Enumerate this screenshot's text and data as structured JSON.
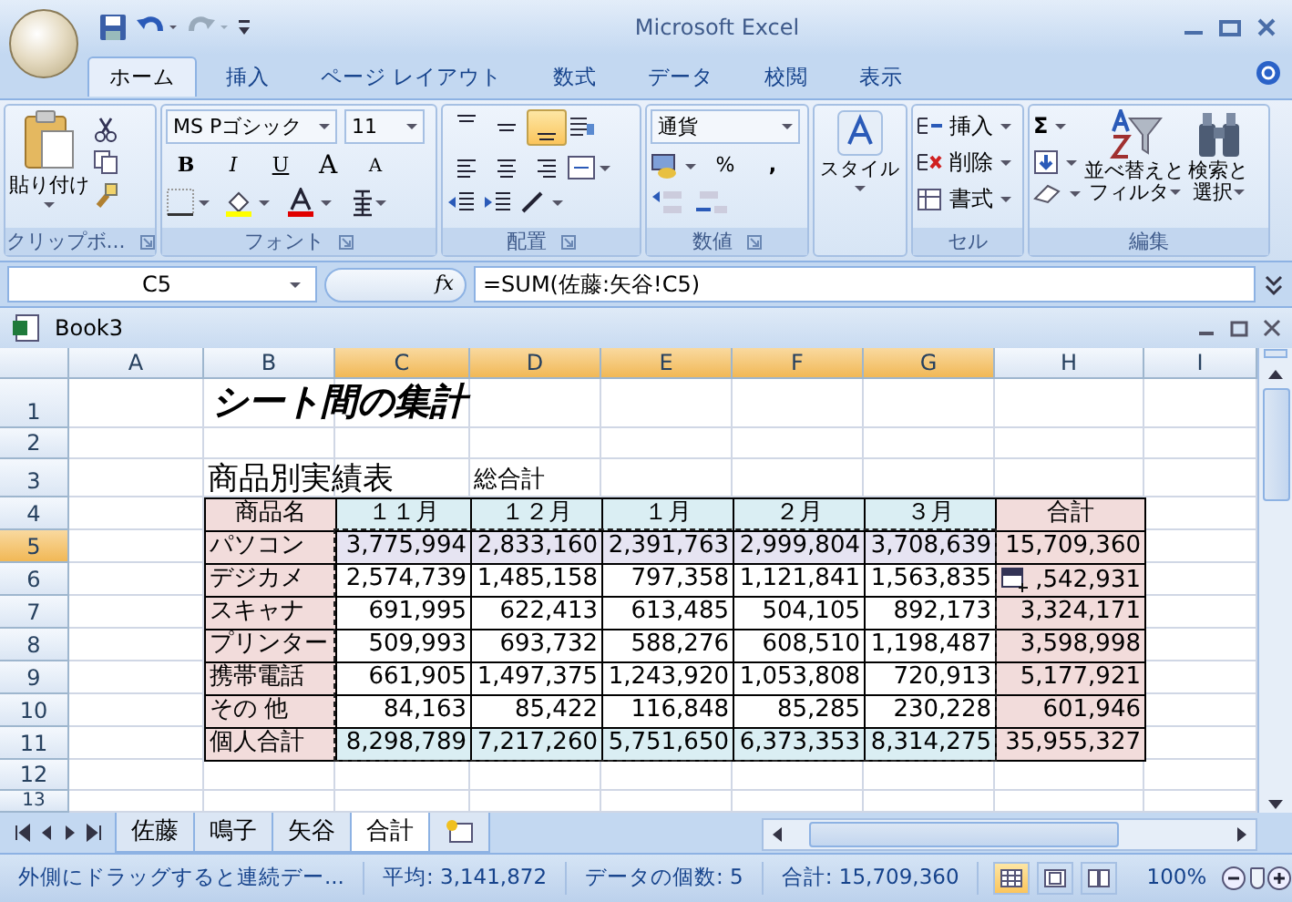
{
  "window": {
    "title": "Microsoft Excel"
  },
  "ribbon_tabs": [
    {
      "label": "ホーム",
      "selected": true
    },
    {
      "label": "挿入",
      "selected": false
    },
    {
      "label": "ページ レイアウト",
      "selected": false
    },
    {
      "label": "数式",
      "selected": false
    },
    {
      "label": "データ",
      "selected": false
    },
    {
      "label": "校閲",
      "selected": false
    },
    {
      "label": "表示",
      "selected": false
    }
  ],
  "clipboard": {
    "paste": "貼り付け",
    "label": "クリップボ..."
  },
  "font": {
    "name": "MS Pゴシック",
    "size": "11",
    "styles": [
      "B",
      "I",
      "U"
    ],
    "grow": "A",
    "shrink": "A",
    "label": "フォント"
  },
  "alignment": {
    "vertical": [
      {
        "selected": false
      },
      {
        "selected": false
      },
      {
        "selected": true
      }
    ],
    "label": "配置"
  },
  "number": {
    "format": "通貨",
    "percent": "%",
    "comma": ",",
    "label": "数値"
  },
  "styles": {
    "button": "スタイル"
  },
  "cells": {
    "buttons": [
      "挿入",
      "削除",
      "書式"
    ],
    "label": "セル"
  },
  "editing": {
    "sum": "Σ",
    "sort": [
      "並べ替えと",
      "フィルタ"
    ],
    "find": [
      "検索と",
      "選択"
    ],
    "label": "編集"
  },
  "formula_bar": {
    "name_box": "C5",
    "fx": "fx",
    "formula": "=SUM(佐藤:矢谷!C5)"
  },
  "workbook": {
    "title": "Book3"
  },
  "sheet": {
    "columns": [
      {
        "label": "A",
        "selected": false
      },
      {
        "label": "B",
        "selected": false
      },
      {
        "label": "C",
        "selected": true
      },
      {
        "label": "D",
        "selected": true
      },
      {
        "label": "E",
        "selected": true
      },
      {
        "label": "F",
        "selected": true
      },
      {
        "label": "G",
        "selected": true
      },
      {
        "label": "H",
        "selected": false
      },
      {
        "label": "I",
        "selected": false
      }
    ],
    "rows": [
      {
        "label": "1",
        "selected": false
      },
      {
        "label": "2",
        "selected": false
      },
      {
        "label": "3",
        "selected": false
      },
      {
        "label": "4",
        "selected": false
      },
      {
        "label": "5",
        "selected": true
      },
      {
        "label": "6",
        "selected": false
      },
      {
        "label": "7",
        "selected": false
      },
      {
        "label": "8",
        "selected": false
      },
      {
        "label": "9",
        "selected": false
      },
      {
        "label": "10",
        "selected": false
      },
      {
        "label": "11",
        "selected": false
      },
      {
        "label": "12",
        "selected": false
      },
      {
        "label": "13",
        "selected": false
      }
    ],
    "title": "シート間の集計",
    "table_title": "商品別実績表",
    "table_note": "総合計",
    "table": {
      "columns": [
        "商品名",
        "１１月",
        "１２月",
        "１月",
        "２月",
        "３月",
        "合計"
      ],
      "rows": [
        {
          "selected": true,
          "paste_options": false,
          "cells": [
            "パソコン",
            "3,775,994",
            "2,833,160",
            "2,391,763",
            "2,999,804",
            "3,708,639",
            "15,709,360"
          ]
        },
        {
          "selected": false,
          "paste_options": true,
          "cells": [
            "デジカメ",
            "2,574,739",
            "1,485,158",
            "797,358",
            "1,121,841",
            "1,563,835",
            ",542,931"
          ]
        },
        {
          "selected": false,
          "paste_options": false,
          "cells": [
            "スキャナ",
            "691,995",
            "622,413",
            "613,485",
            "504,105",
            "892,173",
            "3,324,171"
          ]
        },
        {
          "selected": false,
          "paste_options": false,
          "cells": [
            "プリンター",
            "509,993",
            "693,732",
            "588,276",
            "608,510",
            "1,198,487",
            "3,598,998"
          ]
        },
        {
          "selected": false,
          "paste_options": false,
          "cells": [
            "携帯電話",
            "661,905",
            "1,497,375",
            "1,243,920",
            "1,053,808",
            "720,913",
            "5,177,921"
          ]
        },
        {
          "selected": false,
          "paste_options": false,
          "cells": [
            "その 他",
            "84,163",
            "85,422",
            "116,848",
            "85,285",
            "230,228",
            "601,946"
          ]
        },
        {
          "selected": false,
          "paste_options": false,
          "cells": [
            "個人合計",
            "8,298,789",
            "7,217,260",
            "5,751,650",
            "6,373,353",
            "8,314,275",
            "35,955,327"
          ]
        }
      ]
    }
  },
  "sheet_tabs": [
    {
      "label": "佐藤",
      "selected": false
    },
    {
      "label": "鳴子",
      "selected": false
    },
    {
      "label": "矢谷",
      "selected": false
    },
    {
      "label": "合計",
      "selected": true
    }
  ],
  "status_bar": {
    "message": "外側にドラッグすると連続デー...",
    "average": "平均: 3,141,872",
    "count": "データの個数: 5",
    "sum": "合計: 15,709,360",
    "views": [
      {
        "selected": true
      },
      {
        "selected": false
      },
      {
        "selected": false
      }
    ],
    "zoom": "100%",
    "zoom_slider": {
      "level": 0.5
    }
  }
}
